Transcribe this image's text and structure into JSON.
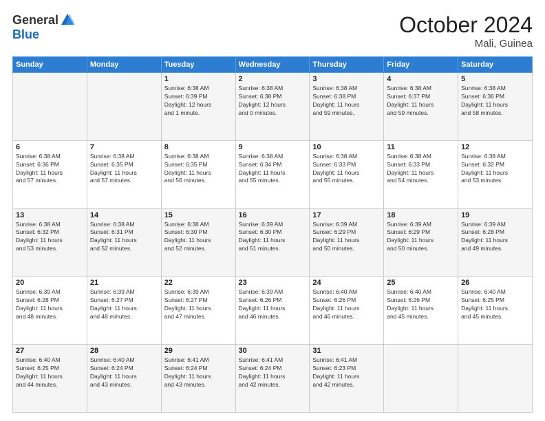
{
  "header": {
    "logo_general": "General",
    "logo_blue": "Blue",
    "month_title": "October 2024",
    "location": "Mali, Guinea"
  },
  "days_of_week": [
    "Sunday",
    "Monday",
    "Tuesday",
    "Wednesday",
    "Thursday",
    "Friday",
    "Saturday"
  ],
  "weeks": [
    [
      {
        "day": "",
        "info": ""
      },
      {
        "day": "",
        "info": ""
      },
      {
        "day": "1",
        "info": "Sunrise: 6:38 AM\nSunset: 6:39 PM\nDaylight: 12 hours\nand 1 minute."
      },
      {
        "day": "2",
        "info": "Sunrise: 6:38 AM\nSunset: 6:38 PM\nDaylight: 12 hours\nand 0 minutes."
      },
      {
        "day": "3",
        "info": "Sunrise: 6:38 AM\nSunset: 6:38 PM\nDaylight: 11 hours\nand 59 minutes."
      },
      {
        "day": "4",
        "info": "Sunrise: 6:38 AM\nSunset: 6:37 PM\nDaylight: 11 hours\nand 59 minutes."
      },
      {
        "day": "5",
        "info": "Sunrise: 6:38 AM\nSunset: 6:36 PM\nDaylight: 11 hours\nand 58 minutes."
      }
    ],
    [
      {
        "day": "6",
        "info": "Sunrise: 6:38 AM\nSunset: 6:36 PM\nDaylight: 11 hours\nand 57 minutes."
      },
      {
        "day": "7",
        "info": "Sunrise: 6:38 AM\nSunset: 6:35 PM\nDaylight: 11 hours\nand 57 minutes."
      },
      {
        "day": "8",
        "info": "Sunrise: 6:38 AM\nSunset: 6:35 PM\nDaylight: 11 hours\nand 56 minutes."
      },
      {
        "day": "9",
        "info": "Sunrise: 6:38 AM\nSunset: 6:34 PM\nDaylight: 11 hours\nand 55 minutes."
      },
      {
        "day": "10",
        "info": "Sunrise: 6:38 AM\nSunset: 6:33 PM\nDaylight: 11 hours\nand 55 minutes."
      },
      {
        "day": "11",
        "info": "Sunrise: 6:38 AM\nSunset: 6:33 PM\nDaylight: 11 hours\nand 54 minutes."
      },
      {
        "day": "12",
        "info": "Sunrise: 6:38 AM\nSunset: 6:32 PM\nDaylight: 11 hours\nand 53 minutes."
      }
    ],
    [
      {
        "day": "13",
        "info": "Sunrise: 6:38 AM\nSunset: 6:32 PM\nDaylight: 11 hours\nand 53 minutes."
      },
      {
        "day": "14",
        "info": "Sunrise: 6:38 AM\nSunset: 6:31 PM\nDaylight: 11 hours\nand 52 minutes."
      },
      {
        "day": "15",
        "info": "Sunrise: 6:38 AM\nSunset: 6:30 PM\nDaylight: 11 hours\nand 52 minutes."
      },
      {
        "day": "16",
        "info": "Sunrise: 6:39 AM\nSunset: 6:30 PM\nDaylight: 11 hours\nand 51 minutes."
      },
      {
        "day": "17",
        "info": "Sunrise: 6:39 AM\nSunset: 6:29 PM\nDaylight: 11 hours\nand 50 minutes."
      },
      {
        "day": "18",
        "info": "Sunrise: 6:39 AM\nSunset: 6:29 PM\nDaylight: 11 hours\nand 50 minutes."
      },
      {
        "day": "19",
        "info": "Sunrise: 6:39 AM\nSunset: 6:28 PM\nDaylight: 11 hours\nand 49 minutes."
      }
    ],
    [
      {
        "day": "20",
        "info": "Sunrise: 6:39 AM\nSunset: 6:28 PM\nDaylight: 11 hours\nand 48 minutes."
      },
      {
        "day": "21",
        "info": "Sunrise: 6:39 AM\nSunset: 6:27 PM\nDaylight: 11 hours\nand 48 minutes."
      },
      {
        "day": "22",
        "info": "Sunrise: 6:39 AM\nSunset: 6:27 PM\nDaylight: 11 hours\nand 47 minutes."
      },
      {
        "day": "23",
        "info": "Sunrise: 6:39 AM\nSunset: 6:26 PM\nDaylight: 11 hours\nand 46 minutes."
      },
      {
        "day": "24",
        "info": "Sunrise: 6:40 AM\nSunset: 6:26 PM\nDaylight: 11 hours\nand 46 minutes."
      },
      {
        "day": "25",
        "info": "Sunrise: 6:40 AM\nSunset: 6:26 PM\nDaylight: 11 hours\nand 45 minutes."
      },
      {
        "day": "26",
        "info": "Sunrise: 6:40 AM\nSunset: 6:25 PM\nDaylight: 11 hours\nand 45 minutes."
      }
    ],
    [
      {
        "day": "27",
        "info": "Sunrise: 6:40 AM\nSunset: 6:25 PM\nDaylight: 11 hours\nand 44 minutes."
      },
      {
        "day": "28",
        "info": "Sunrise: 6:40 AM\nSunset: 6:24 PM\nDaylight: 11 hours\nand 43 minutes."
      },
      {
        "day": "29",
        "info": "Sunrise: 6:41 AM\nSunset: 6:24 PM\nDaylight: 11 hours\nand 43 minutes."
      },
      {
        "day": "30",
        "info": "Sunrise: 6:41 AM\nSunset: 6:24 PM\nDaylight: 11 hours\nand 42 minutes."
      },
      {
        "day": "31",
        "info": "Sunrise: 6:41 AM\nSunset: 6:23 PM\nDaylight: 11 hours\nand 42 minutes."
      },
      {
        "day": "",
        "info": ""
      },
      {
        "day": "",
        "info": ""
      }
    ]
  ]
}
